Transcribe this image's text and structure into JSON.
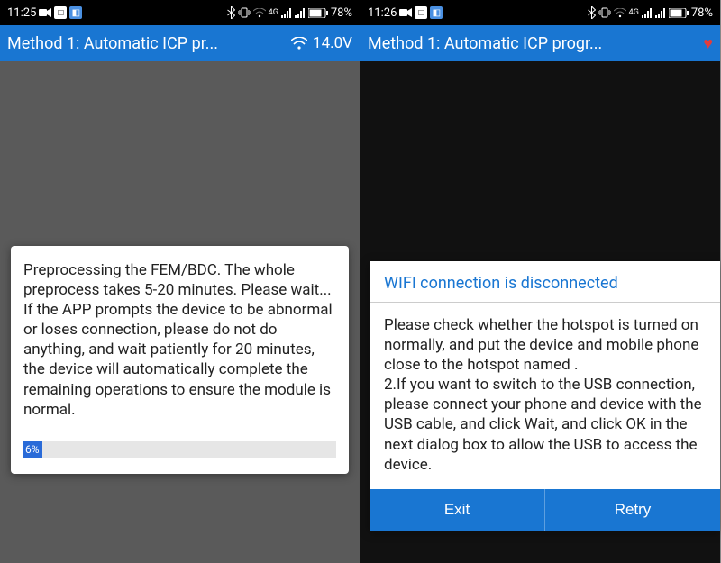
{
  "left": {
    "status": {
      "time": "11:25",
      "battery_pct": "78%"
    },
    "header": {
      "title": "Method 1: Automatic ICP pr...",
      "voltage": "14.0V"
    },
    "dialog": {
      "body": "Preprocessing the FEM/BDC. The whole preprocess takes 5-20 minutes. Please wait...\nIf the APP prompts the device to be abnormal or loses connection, please do not do anything, and wait patiently for 20 minutes, the device will automatically complete the remaining operations to ensure the module is normal.",
      "progress_pct": "6%"
    }
  },
  "right": {
    "status": {
      "time": "11:26",
      "battery_pct": "78%"
    },
    "header": {
      "title": "Method 1: Automatic ICP progr..."
    },
    "dialog": {
      "title": "WIFI connection is disconnected",
      "body": "Please check whether the hotspot is turned on normally, and put the device and mobile phone close to the hotspot named .\n2.If you want to switch to the USB connection, please connect your phone and device with the USB cable,  and click Wait, and click OK in the next dialog box to allow the USB to access the device.",
      "exit_label": "Exit",
      "retry_label": "Retry"
    }
  }
}
